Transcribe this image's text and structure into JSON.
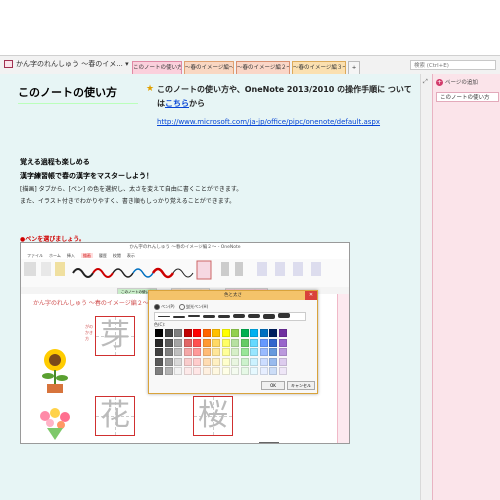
{
  "header": {
    "notebook_title": "かん字のれんしゅう ～春のイメ...",
    "tabs": [
      "このノートの使い方",
      "～春のイメージ編～",
      "～春のイメージ編２～",
      "～春のイメージ編３～",
      "+"
    ],
    "search_placeholder": "検索 (Ctrl+E)"
  },
  "right_pane": {
    "add_page_label": "ページの追加",
    "pages": [
      "このノートの使い方"
    ]
  },
  "page": {
    "title": "このノートの使い方",
    "intro_before_link": "このノートの使い方や、OneNote 2013/2010 の操作手順に ついては",
    "intro_link": "こちら",
    "intro_after_link": "から",
    "url": "http://www.microsoft.com/ja-jp/office/pipc/onenote/default.aspx",
    "heading1": "覚える過程も楽しめる",
    "heading2": "漢字練習帳で春の漢字をマスターしよう！",
    "para1": "[描画] タブから、[ペン] の色を選択し、太さを変えて自由に書くことができます。",
    "para2": "また、イラスト付きでわかりやすく、書き順もしっかり覚えることができます。",
    "pen_label": "ペンを選びましょう。"
  },
  "embedded": {
    "window_title": "かん字のれんしゅう ～春のイメージ編２～ - OneNote",
    "menu": [
      "ファイル",
      "ホーム",
      "挿入",
      "描画",
      "履歴",
      "校閲",
      "表示"
    ],
    "selected_menu": "描画",
    "tabs": [
      "このノートの使い方",
      "～春のイメージ編～",
      "～春のイメージ編２～"
    ],
    "page_title": "かん字のれんしゅう ～春のイメージ編２～",
    "kanji": [
      "芽",
      "花",
      "桜"
    ],
    "side_label": "がの かき方",
    "dialog": {
      "title": "色と太さ",
      "radio_pen": "ペン(P)",
      "radio_highlighter": "蛍光ペン(H)",
      "color_label": "色(C):",
      "ok": "OK",
      "cancel": "キャンセル"
    }
  },
  "colors": {
    "active_tab": "#fbd0dc",
    "link": "#0645d6",
    "red_label": "#d00000",
    "canvas_bg": "#e7f5f5"
  },
  "swatch_colors": [
    "#000000",
    "#404040",
    "#7f7f7f",
    "#c00000",
    "#ff0000",
    "#ff6600",
    "#ffc000",
    "#ffff00",
    "#92d050",
    "#00b050",
    "#00b0f0",
    "#0070c0",
    "#002060",
    "#7030a0",
    "#262626",
    "#595959",
    "#a5a5a5",
    "#e06666",
    "#ff5050",
    "#ff9933",
    "#ffd966",
    "#ffff66",
    "#b7e1a1",
    "#66cc66",
    "#66d9ff",
    "#6699ff",
    "#3366cc",
    "#9966cc",
    "#404040",
    "#808080",
    "#bfbfbf",
    "#f4a7a7",
    "#ff9999",
    "#ffbb77",
    "#ffe699",
    "#ffff99",
    "#d6efc7",
    "#99e699",
    "#99e6ff",
    "#99bbff",
    "#6699dd",
    "#bb99dd",
    "#595959",
    "#999999",
    "#d9d9d9",
    "#f9cccc",
    "#ffcccc",
    "#ffdcb3",
    "#fff0c2",
    "#ffffcc",
    "#e9f6e0",
    "#ccf2cc",
    "#ccf2ff",
    "#ccddff",
    "#99bbee",
    "#ddccee",
    "#7f7f7f",
    "#b3b3b3",
    "#f2f2f2",
    "#fde9e9",
    "#ffe6e6",
    "#fff0e0",
    "#fff8e0",
    "#ffffe6",
    "#f4fbef",
    "#e6f9e6",
    "#e6f9ff",
    "#e6eeff",
    "#ccddf7",
    "#eee6f7"
  ]
}
